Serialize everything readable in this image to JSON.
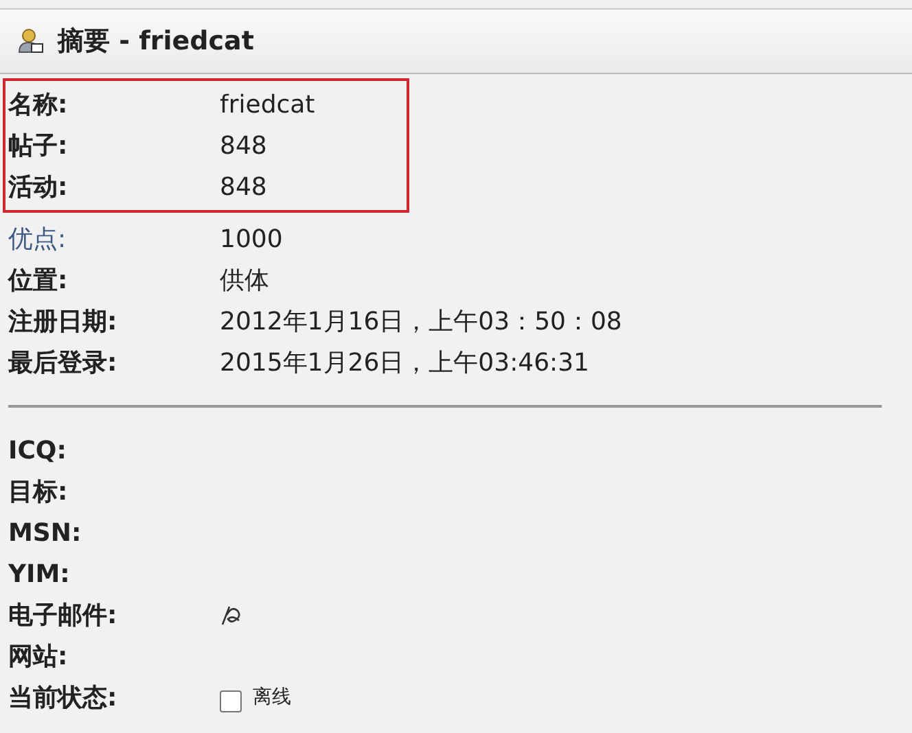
{
  "header": {
    "title": "摘要 - friedcat"
  },
  "groups": [
    {
      "highlighted": true,
      "rows": [
        {
          "label": "名称:",
          "value": "friedcat",
          "link": false
        },
        {
          "label": "帖子:",
          "value": "848",
          "link": false
        },
        {
          "label": "活动:",
          "value": "848",
          "link": false
        }
      ]
    },
    {
      "highlighted": false,
      "rows": [
        {
          "label": "优点:",
          "value": "1000",
          "link": true
        },
        {
          "label": "位置:",
          "value": "供体",
          "link": false
        },
        {
          "label": "注册日期:",
          "value": "2012年1月16日，上午03：50：08",
          "link": false
        },
        {
          "label": "最后登录:",
          "value": "2015年1月26日，上午03:46:31",
          "link": false
        }
      ]
    }
  ],
  "contact_rows": [
    {
      "kind": "text",
      "label": "ICQ:"
    },
    {
      "kind": "text",
      "label": "目标:"
    },
    {
      "kind": "text",
      "label": "MSN:"
    },
    {
      "kind": "text",
      "label": "YIM:"
    },
    {
      "kind": "email",
      "label": "电子邮件:"
    },
    {
      "kind": "text",
      "label": "网站:"
    },
    {
      "kind": "status",
      "label": "当前状态:",
      "checked": false,
      "status": "离线"
    }
  ]
}
